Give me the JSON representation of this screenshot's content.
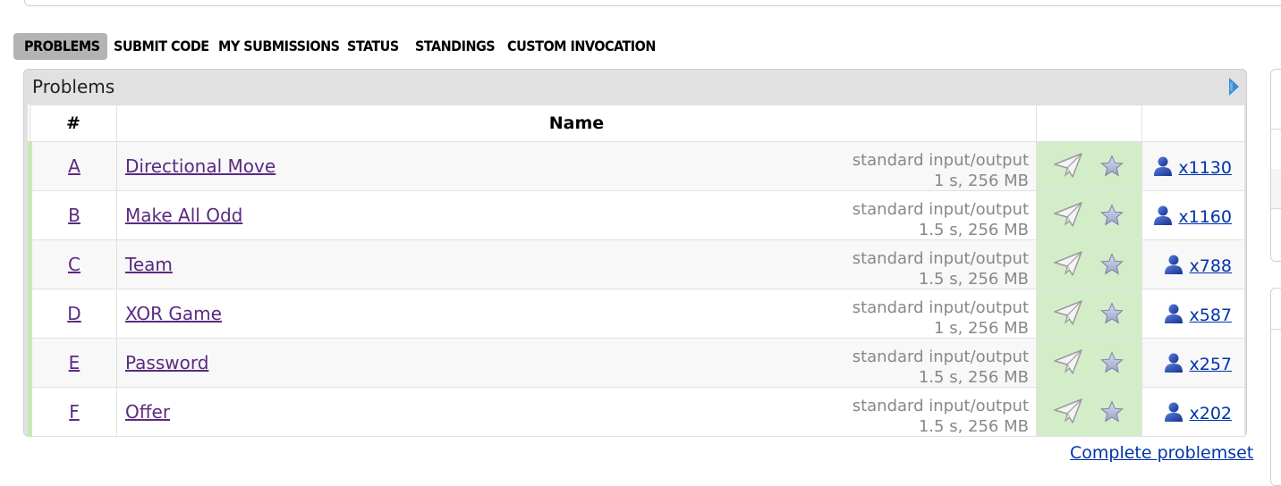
{
  "menu": {
    "items": [
      {
        "label": "PROBLEMS",
        "active": true
      },
      {
        "label": "SUBMIT CODE"
      },
      {
        "label": "MY SUBMISSIONS"
      },
      {
        "label": "STATUS"
      },
      {
        "label": "STANDINGS"
      },
      {
        "label": "CUSTOM INVOCATION"
      }
    ]
  },
  "problems_box": {
    "caption": "Problems",
    "headers": {
      "index": "#",
      "name": "Name"
    },
    "rows": [
      {
        "index": "A",
        "name": "Directional Move",
        "io": "standard input/output",
        "limits": "1 s, 256 MB",
        "solved": "x1130"
      },
      {
        "index": "B",
        "name": "Make All Odd",
        "io": "standard input/output",
        "limits": "1.5 s, 256 MB",
        "solved": "x1160"
      },
      {
        "index": "C",
        "name": "Team",
        "io": "standard input/output",
        "limits": "1.5 s, 256 MB",
        "solved": "x788"
      },
      {
        "index": "D",
        "name": "XOR Game",
        "io": "standard input/output",
        "limits": "1 s, 256 MB",
        "solved": "x587"
      },
      {
        "index": "E",
        "name": "Password",
        "io": "standard input/output",
        "limits": "1.5 s, 256 MB",
        "solved": "x257"
      },
      {
        "index": "F",
        "name": "Offer",
        "io": "standard input/output",
        "limits": "1.5 s, 256 MB",
        "solved": "x202"
      }
    ]
  },
  "footer": {
    "complete_link": "Complete problemset"
  },
  "icons": {
    "submit": "paper-plane-icon",
    "favourite": "star-icon",
    "solved_by": "user-icon",
    "expand": "arrow-right-icon"
  },
  "colors": {
    "accepted_bg": "#d4edc9",
    "active_tab": "#b3b3b3",
    "link": "#5a2a82",
    "solved_link": "#0033aa"
  }
}
